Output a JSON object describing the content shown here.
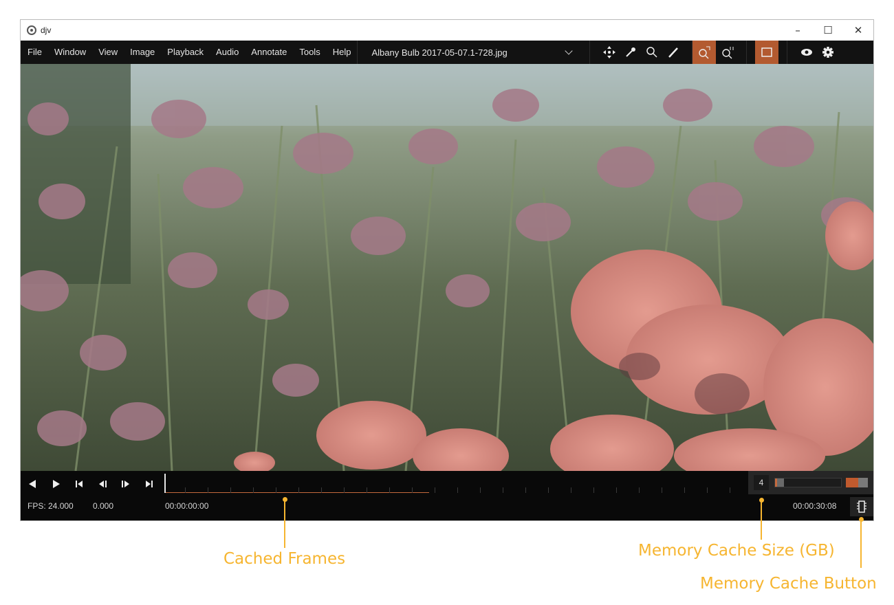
{
  "window": {
    "app_title": "djv",
    "minimize": "–",
    "maximize": "☐",
    "close": "✕"
  },
  "menubar": {
    "items": [
      "File",
      "Window",
      "View",
      "Image",
      "Playback",
      "Audio",
      "Annotate",
      "Tools",
      "Help"
    ],
    "current_file": "Albany Bulb 2017-05-07.1-728.jpg"
  },
  "toolbar": {
    "tools": [
      "move-icon",
      "color-picker-icon",
      "magnifier-icon",
      "annotate-pen-icon"
    ],
    "zoom": [
      "zoom-fit-icon",
      "zoom-reset-icon"
    ],
    "active": [
      "zoom-fit-icon",
      "frame-view-icon"
    ],
    "right": [
      "eye-icon",
      "settings-gear-icon"
    ]
  },
  "viewer": {
    "image": "wildflowers-photo"
  },
  "timeline": {
    "fps_label": "FPS: 24.000",
    "speed": "0.000",
    "current_time": "00:00:00:00",
    "end_time": "00:00:30:08",
    "cached_fraction": 0.44
  },
  "cache": {
    "size_gb": "4",
    "usage_fraction": 0.14,
    "accent_color": "#c56a3e"
  },
  "callouts": {
    "cached_frames": "Cached Frames",
    "memory_cache_size": "Memory Cache Size (GB)",
    "memory_cache_button": "Memory Cache Button"
  },
  "colors": {
    "accent": "#b35a30",
    "callout": "#f6b530",
    "menubar": "#121212"
  }
}
